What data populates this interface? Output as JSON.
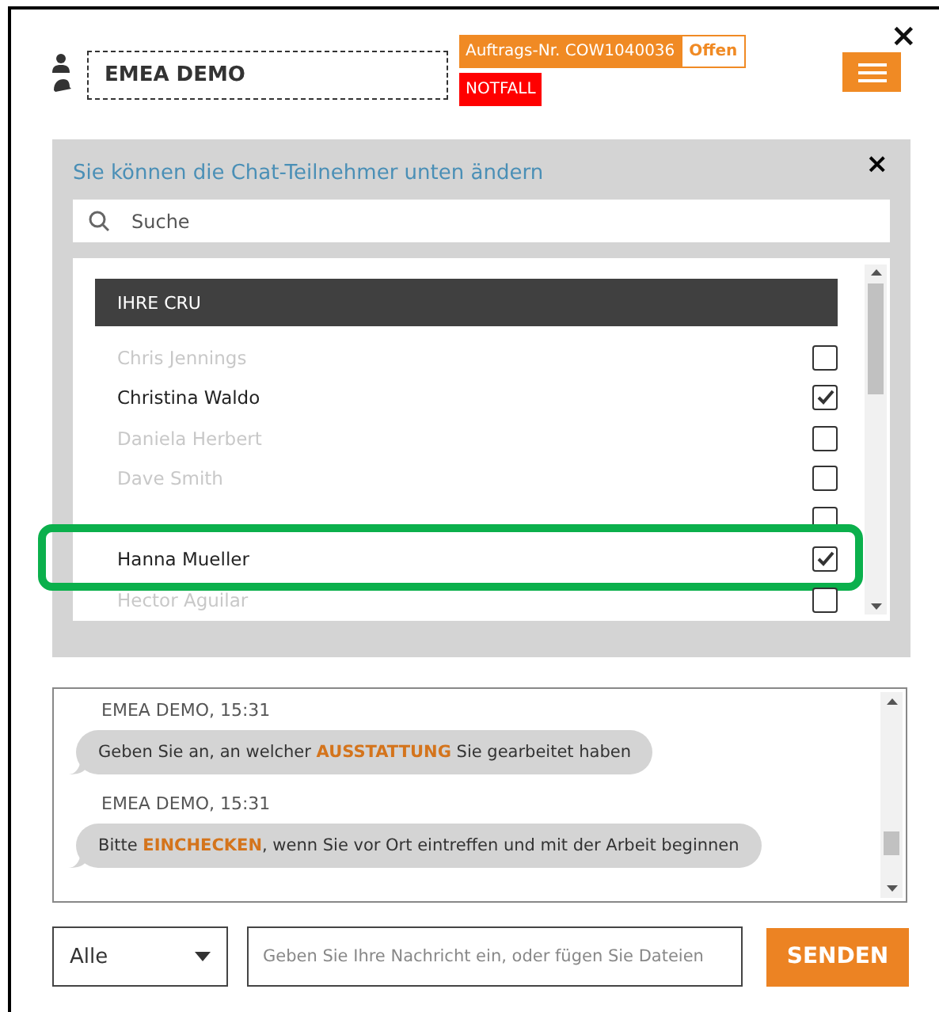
{
  "header": {
    "user_name": "EMEA DEMO",
    "order_label": "Auftrags-Nr. COW1040036",
    "order_status": "Offen",
    "priority": "NOTFALL",
    "close": "×"
  },
  "participants_panel": {
    "title": "Sie können die Chat-Teilnehmer unten ändern",
    "close": "×",
    "search": {
      "placeholder": "Suche"
    },
    "group": "IHRE CRU",
    "people": [
      {
        "name": "Chris Jennings",
        "disabled": true,
        "checked": false,
        "highlighted": false
      },
      {
        "name": "Christina Waldo",
        "disabled": false,
        "checked": true,
        "highlighted": false
      },
      {
        "name": "Daniela Herbert",
        "disabled": true,
        "checked": false,
        "highlighted": false
      },
      {
        "name": "Dave Smith",
        "disabled": true,
        "checked": false,
        "highlighted": false
      },
      {
        "checked": false
      },
      {
        "name": "Hanna Mueller",
        "disabled": false,
        "checked": true,
        "highlighted": true
      },
      {
        "name": "Hector Aguilar",
        "disabled": true,
        "checked": false,
        "highlighted": false
      }
    ]
  },
  "messages": [
    {
      "meta": "EMEA DEMO, 15:31",
      "text": "Geben Sie an, an welcher **AUSSTATTUNG** Sie gearbeitet haben"
    },
    {
      "meta": "EMEA DEMO, 15:31",
      "text": "Bitte **EINCHECKEN**, wenn Sie vor Ort eintreffen und mit der Arbeit beginnen"
    }
  ],
  "composer": {
    "recipient": "Alle",
    "placeholder": "Geben Sie Ihre Nachricht ein, oder fügen Sie Dateien",
    "send": "SENDEN"
  }
}
